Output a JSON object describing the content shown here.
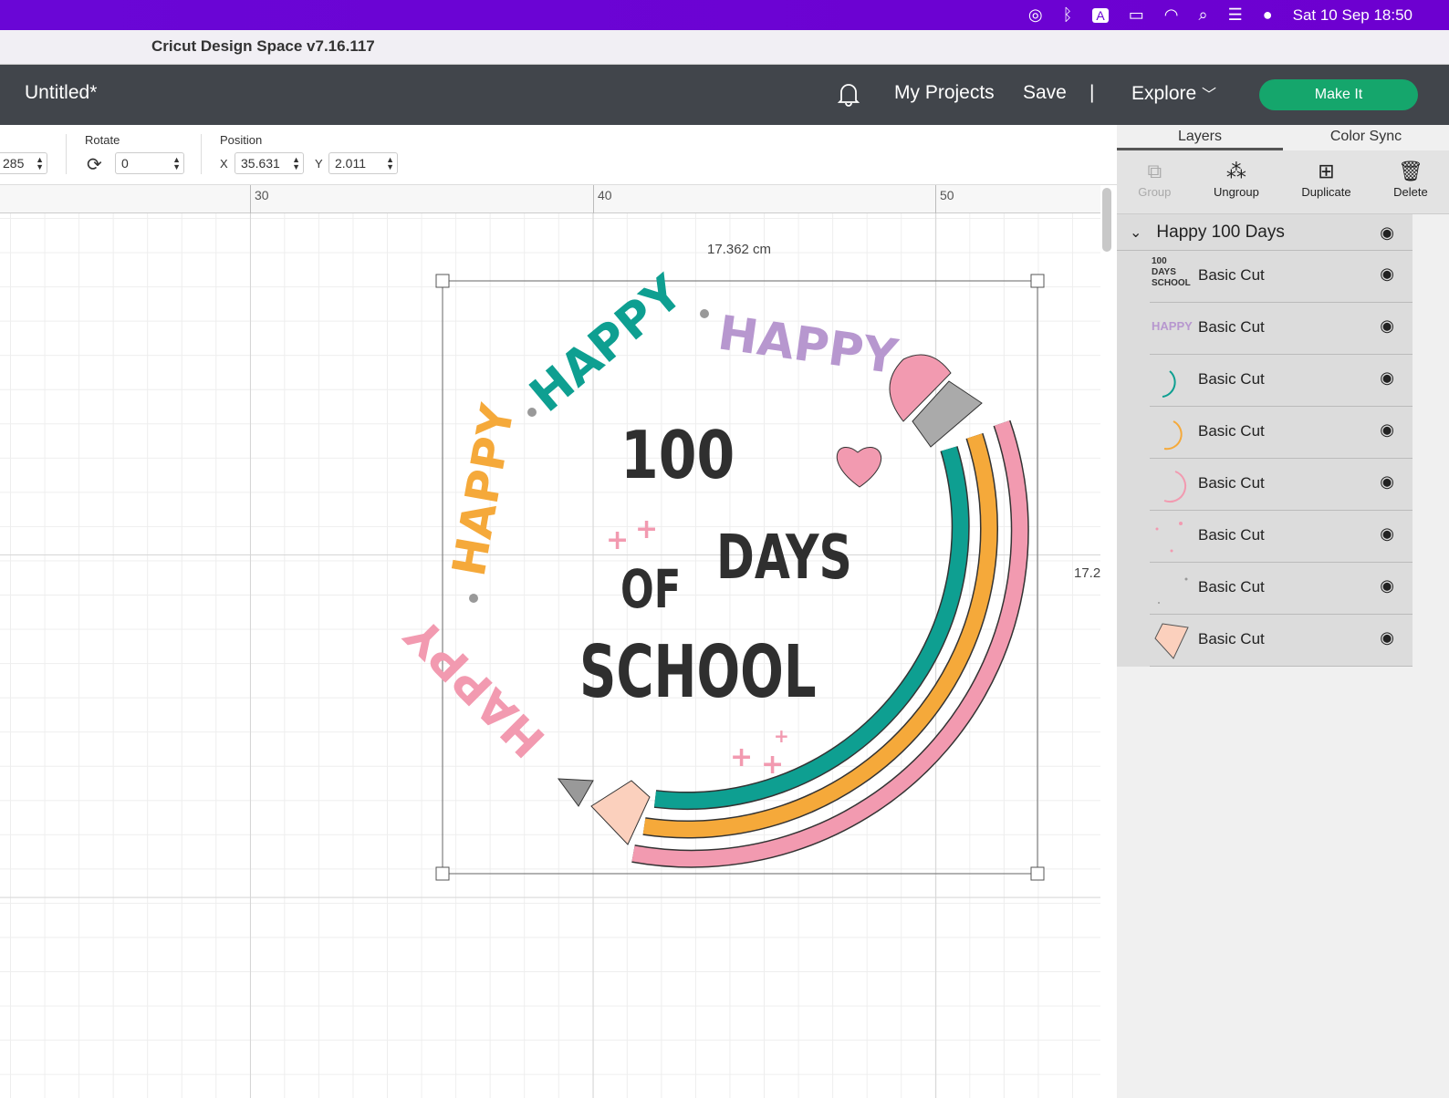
{
  "menubar": {
    "datetime": "Sat 10 Sep  18:50",
    "icons": [
      "creative-cloud-icon",
      "bluetooth-icon",
      "input-source-icon",
      "battery-icon",
      "wifi-icon",
      "spotlight-icon",
      "control-center-icon",
      "siri-icon"
    ],
    "input_letter": "A"
  },
  "window": {
    "title": "Cricut Design Space  v7.16.117"
  },
  "header": {
    "doc_title": "Untitled*",
    "my_projects": "My Projects",
    "save": "Save",
    "divider": "|",
    "explore": "Explore",
    "make_it": "Make It"
  },
  "toolbar": {
    "size_value": "285",
    "rotate_label": "Rotate",
    "rotate_value": "0",
    "position_label": "Position",
    "x_label": "X",
    "x_value": "35.631",
    "y_label": "Y",
    "y_value": "2.011"
  },
  "ruler": {
    "ticks": [
      "30",
      "40",
      "50"
    ]
  },
  "selection": {
    "width_label": "17.362 cm",
    "height_label": "17.2"
  },
  "design": {
    "happy": "HAPPY",
    "number": "100",
    "days": "DAYS",
    "of": "OF",
    "school": "SCHOOL",
    "colors": {
      "teal": "#0e9f91",
      "orange": "#f5a93a",
      "pink": "#f29ab0",
      "purple": "#b797cf",
      "dark": "#2f2f2f",
      "peach": "#fbd0bd"
    }
  },
  "panel": {
    "tabs": [
      "Layers",
      "Color Sync"
    ],
    "actions": [
      "Group",
      "Ungroup",
      "Duplicate",
      "Delete"
    ],
    "group_name": "Happy 100 Days",
    "layers": [
      {
        "name": "Basic Cut"
      },
      {
        "name": "Basic Cut"
      },
      {
        "name": "Basic Cut"
      },
      {
        "name": "Basic Cut"
      },
      {
        "name": "Basic Cut"
      },
      {
        "name": "Basic Cut"
      },
      {
        "name": "Basic Cut"
      },
      {
        "name": "Basic Cut"
      }
    ]
  },
  "accent": "#15a66c"
}
